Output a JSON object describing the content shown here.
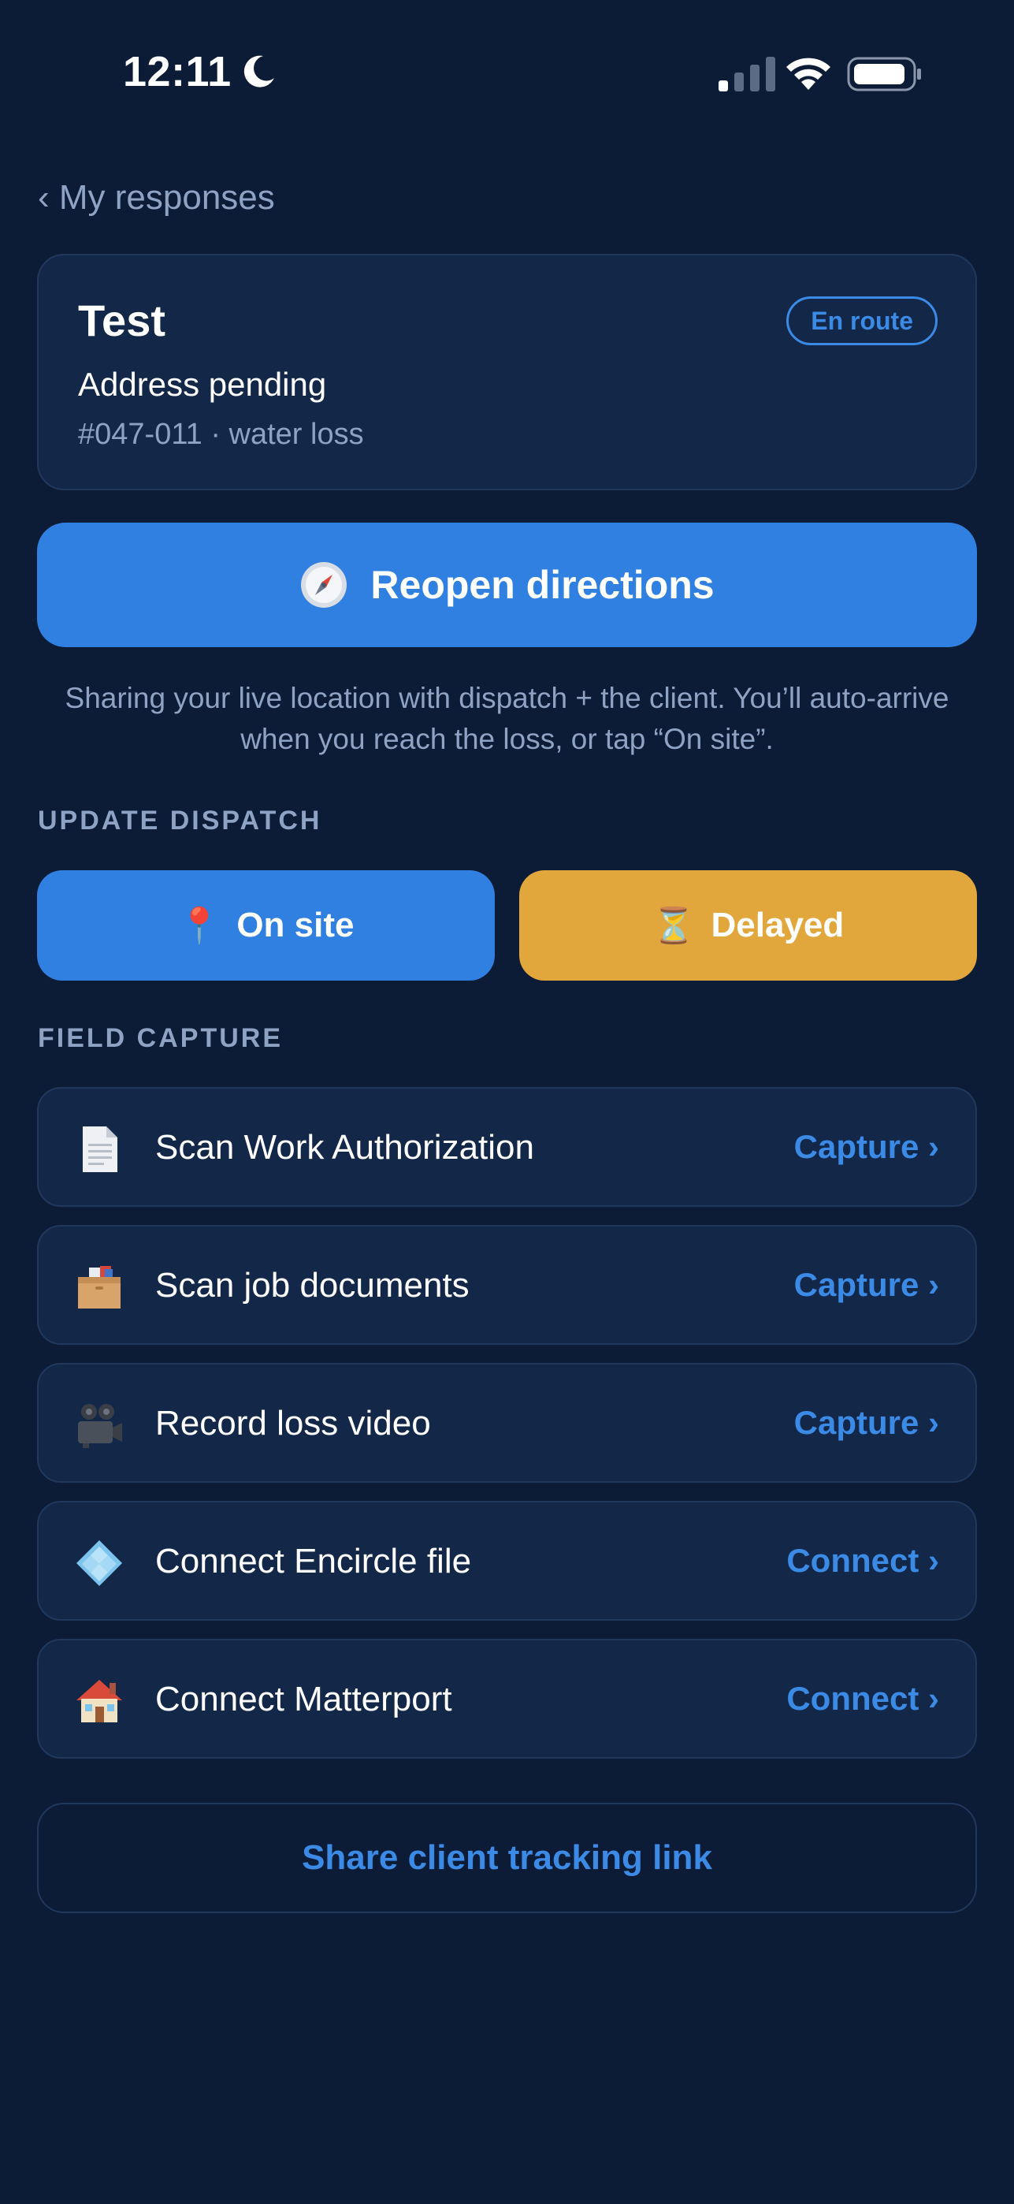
{
  "status_bar": {
    "time": "12:11",
    "icons": [
      "moon-icon",
      "signal-icon",
      "wifi-icon",
      "battery-icon"
    ]
  },
  "nav": {
    "back_label": "‹ My responses"
  },
  "job": {
    "title": "Test",
    "status": "En route",
    "address": "Address pending",
    "meta": "#047-011 · water loss"
  },
  "directions": {
    "label": "Reopen directions",
    "icon": "compass-icon"
  },
  "sharing_note": "Sharing your live location with dispatch + the client. You’ll auto-arrive when you reach the loss, or tap “On site”.",
  "dispatch": {
    "header": "UPDATE DISPATCH",
    "on_site": {
      "emoji": "📍",
      "label": "On site"
    },
    "delayed": {
      "emoji": "⏳",
      "label": "Delayed"
    }
  },
  "field_capture": {
    "header": "FIELD CAPTURE",
    "items": [
      {
        "icon": "document-icon",
        "label": "Scan Work Authorization",
        "action": "Capture ›"
      },
      {
        "icon": "file-box-icon",
        "label": "Scan job documents",
        "action": "Capture ›"
      },
      {
        "icon": "video-camera-icon",
        "label": "Record loss video",
        "action": "Capture ›"
      },
      {
        "icon": "diamond-tiles-icon",
        "label": "Connect Encircle file",
        "action": "Connect ›"
      },
      {
        "icon": "house-icon",
        "label": "Connect Matterport",
        "action": "Connect ›"
      }
    ]
  },
  "share": {
    "label": "Share client tracking link"
  },
  "colors": {
    "background": "#0c1b36",
    "card": "#132848",
    "primary": "#2f80e0",
    "accent_text": "#3b8ae6",
    "warning": "#e2a73c",
    "muted": "#8ea3c3"
  }
}
